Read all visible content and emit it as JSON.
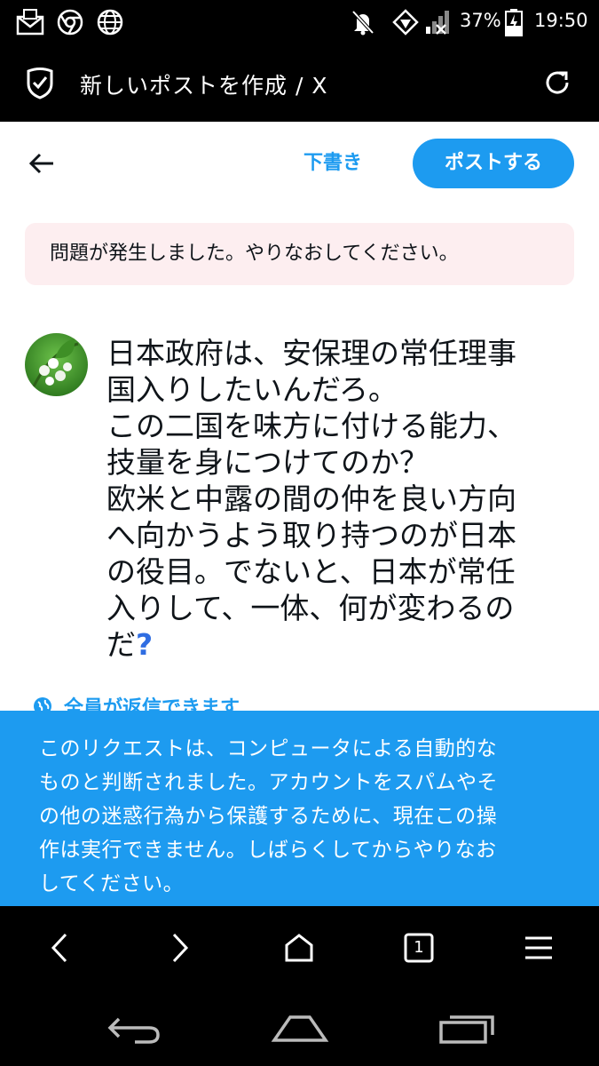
{
  "status_bar": {
    "icons_left": [
      "mail-icon",
      "chrome-icon",
      "globe-icon"
    ],
    "icons_right": [
      "mute-icon",
      "vpn-icon",
      "signal-icon",
      "battery-icon"
    ],
    "battery": "37%",
    "time": "19:50"
  },
  "browser_title": "新しいポストを作成 / X",
  "compose": {
    "draft_label": "下書き",
    "post_label": "ポストする",
    "error_message": "問題が発生しました。やりなおしてください。",
    "post_lines": [
      "日本政府は、安保理の常任理事",
      "国入りしたいんだろ。",
      "この二国を味方に付ける能力、",
      "技量を身につけてのか？",
      "欧米と中露の間の仲を良い方向",
      "へ向かうよう取り持つのが日本",
      "の役目。でないと、日本が常任",
      "入りして、一体、何が変わるの",
      "だ"
    ],
    "post_end_emoji": "?",
    "reply_setting": "全員が返信できます"
  },
  "toast": {
    "lines": [
      "このリクエストは、コンピュータによる自動的な",
      "ものと判断されました。アカウントをスパムやそ",
      "の他の迷惑行為から保護するために、現在この操",
      "作は実行できません。しばらくしてからやりなお",
      "してください。"
    ]
  },
  "browser_nav": {
    "tab_count": "1"
  },
  "colors": {
    "accent": "#1d9bf0",
    "error_bg": "#fdeef0",
    "text": "#0f1419"
  }
}
